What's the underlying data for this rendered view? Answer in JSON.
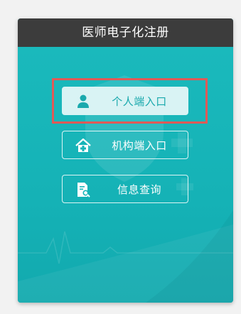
{
  "panel": {
    "title": "医师电子化注册"
  },
  "menu": [
    {
      "label": "个人端入口",
      "icon": "person-icon",
      "state": "selected"
    },
    {
      "label": "机构端入口",
      "icon": "hospital-house-icon",
      "state": "normal"
    },
    {
      "label": "信息查询",
      "icon": "document-search-icon",
      "state": "normal"
    }
  ],
  "colors": {
    "header_bg": "#3c3c3c",
    "panel_bg": "#17b6b9",
    "selected_btn_bg": "#d9f3f4",
    "selected_text": "#1aa9ad",
    "highlight": "#e05a57"
  }
}
